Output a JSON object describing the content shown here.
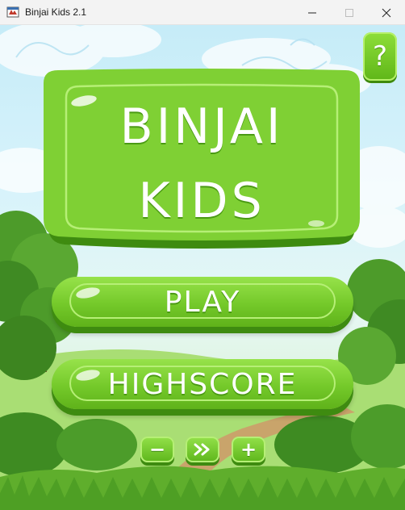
{
  "window": {
    "title": "Binjai Kids 2.1",
    "controls": [
      "minimize",
      "maximize",
      "close"
    ]
  },
  "game": {
    "help_label": "?",
    "title_lines": [
      "BINJAI",
      "KIDS"
    ],
    "menu": {
      "play_label": "PLAY",
      "highscore_label": "HIGHSCORE"
    },
    "small_buttons": {
      "minus_label": "−",
      "skip_icon": "fast-forward-icon",
      "plus_label": "+"
    }
  },
  "colors": {
    "button_green": "#74c92a",
    "button_dark": "#3e8b10",
    "sky": "#cdeff9"
  }
}
